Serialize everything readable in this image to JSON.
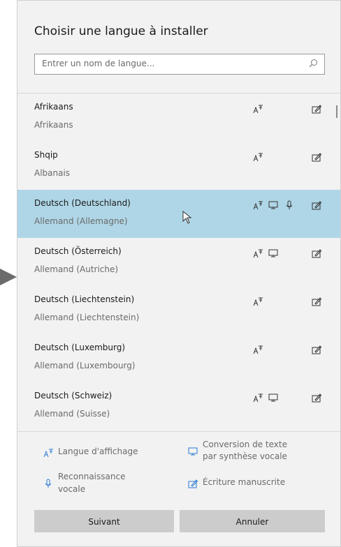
{
  "dialog": {
    "title": "Choisir une langue à installer",
    "search": {
      "placeholder": "Entrer un nom de langue..."
    }
  },
  "languages": [
    {
      "name": "Afrikaans",
      "native": "Afrikaans",
      "features": [
        "display-language",
        "handwriting"
      ],
      "selected": false
    },
    {
      "name": "Shqip",
      "native": "Albanais",
      "features": [
        "display-language",
        "handwriting"
      ],
      "selected": false
    },
    {
      "name": "Deutsch (Deutschland)",
      "native": "Allemand (Allemagne)",
      "features": [
        "display-language",
        "text-to-speech",
        "speech-recognition",
        "handwriting"
      ],
      "selected": true
    },
    {
      "name": "Deutsch (Österreich)",
      "native": "Allemand (Autriche)",
      "features": [
        "display-language",
        "text-to-speech",
        "handwriting"
      ],
      "selected": false
    },
    {
      "name": "Deutsch (Liechtenstein)",
      "native": "Allemand (Liechtenstein)",
      "features": [
        "display-language",
        "handwriting"
      ],
      "selected": false
    },
    {
      "name": "Deutsch (Luxemburg)",
      "native": "Allemand (Luxembourg)",
      "features": [
        "display-language",
        "handwriting"
      ],
      "selected": false
    },
    {
      "name": "Deutsch (Schweiz)",
      "native": "Allemand (Suisse)",
      "features": [
        "display-language",
        "text-to-speech",
        "handwriting"
      ],
      "selected": false
    }
  ],
  "legend": {
    "display_language": "Langue d'affichage",
    "tts_line1": "Conversion de texte",
    "tts_line2": "par synthèse vocale",
    "speech_line1": "Reconnaissance",
    "speech_line2": "vocale",
    "handwriting": "Écriture manuscrite"
  },
  "buttons": {
    "next": "Suivant",
    "cancel": "Annuler"
  },
  "colors": {
    "selected_row": "#afd6e6",
    "icon_blue": "#2a7bd1",
    "button_bg": "#cccccc"
  }
}
